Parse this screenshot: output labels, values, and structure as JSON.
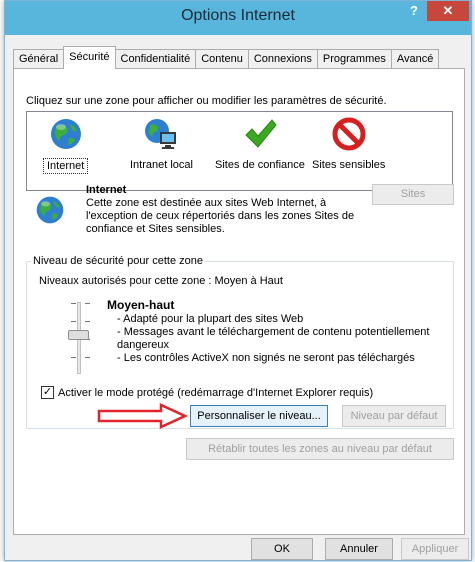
{
  "window": {
    "title": "Options Internet",
    "help_label": "?",
    "close_label": "✕"
  },
  "tabs": [
    {
      "label": "Général",
      "active": false
    },
    {
      "label": "Sécurité",
      "active": true
    },
    {
      "label": "Confidentialité",
      "active": false
    },
    {
      "label": "Contenu",
      "active": false
    },
    {
      "label": "Connexions",
      "active": false
    },
    {
      "label": "Programmes",
      "active": false
    },
    {
      "label": "Avancé",
      "active": false
    }
  ],
  "security": {
    "instruction": "Cliquez sur une zone pour afficher ou modifier les paramètres de sécurité.",
    "zones": [
      {
        "label": "Internet",
        "icon": "globe-icon",
        "selected": true
      },
      {
        "label": "Intranet local",
        "icon": "intranet-icon",
        "selected": false
      },
      {
        "label": "Sites de confiance",
        "icon": "checkmark-icon",
        "selected": false
      },
      {
        "label": "Sites sensibles",
        "icon": "restricted-icon",
        "selected": false
      }
    ],
    "selected_zone": {
      "title": "Internet",
      "description": "Cette zone est destinée aux sites Web Internet, à l'exception de ceux répertoriés dans les zones Sites de confiance et Sites sensibles."
    },
    "sites_button": "Sites",
    "level_group": {
      "legend": "Niveau de sécurité pour cette zone",
      "allowed_levels": "Niveaux autorisés pour cette zone : Moyen à Haut",
      "level_name": "Moyen-haut",
      "level_details": [
        "- Adapté pour la plupart des sites Web",
        "- Messages avant le téléchargement de contenu potentiellement dangereux",
        "- Les contrôles ActiveX non signés ne seront pas téléchargés"
      ],
      "protected_mode": {
        "label": "Activer le mode protégé (redémarrage d'Internet Explorer requis)",
        "checked": true,
        "mark": "✓"
      },
      "custom_level_button": "Personnaliser le niveau...",
      "default_level_button": "Niveau par défaut"
    },
    "reset_all_button": "Rétablir toutes les zones au niveau par défaut"
  },
  "footer": {
    "ok": "OK",
    "cancel": "Annuler",
    "apply": "Appliquer"
  },
  "colors": {
    "titlebar": "#58b5dc",
    "close": "#c7473c",
    "arrow": "#e3232a",
    "check_green": "#3aa820",
    "restricted_red": "#d62020"
  }
}
